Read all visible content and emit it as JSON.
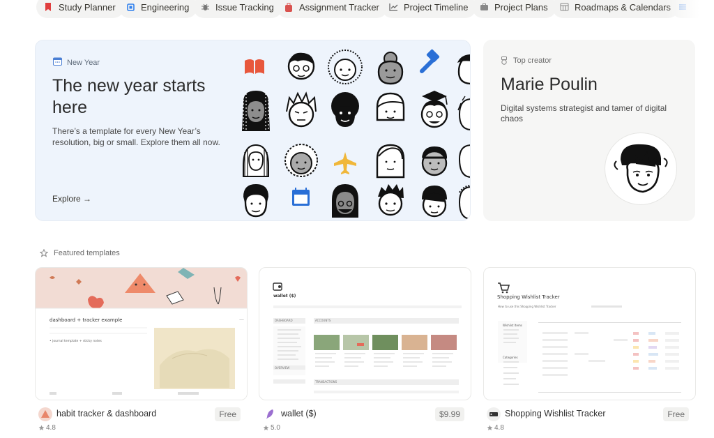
{
  "chips": [
    {
      "label": "Study Planner",
      "icon": "bookmark-icon",
      "color": "#e03e3e"
    },
    {
      "label": "Engineering",
      "icon": "chip-icon",
      "color": "#2f80ed"
    },
    {
      "label": "Issue Tracking",
      "icon": "bug-icon",
      "color": "#6b6b6b"
    },
    {
      "label": "Assignment Tracker",
      "icon": "backpack-icon",
      "color": "#d9534f"
    },
    {
      "label": "Project Timeline",
      "icon": "chart-icon",
      "color": "#6b6b6b"
    },
    {
      "label": "Project Plans",
      "icon": "briefcase-icon",
      "color": "#6b6b6b"
    },
    {
      "label": "Roadmaps & Calendars",
      "icon": "calendar-grid-icon",
      "color": "#6b6b6b"
    }
  ],
  "hero": {
    "eyebrow": "New Year",
    "title": "The new year starts here",
    "description": "There’s a template for every New Year’s resolution, big or small. Explore them all now.",
    "explore": "Explore →",
    "accent": "#eef4fc"
  },
  "creator": {
    "eyebrow": "Top creator",
    "name": "Marie Poulin",
    "bio": "Digital systems strategist and tamer of digital chaos"
  },
  "featured_label": "Featured templates",
  "templates": [
    {
      "title": "habit tracker & dashboard",
      "price": "Free",
      "rating": "4.8",
      "preview": {
        "heading": "dashboard + tracker example",
        "line": "• journal template + sticky notes"
      }
    },
    {
      "title": "wallet ($)",
      "price": "$9.99",
      "rating": "5.0",
      "preview": {
        "heading": "wallet ($)",
        "section1": "DASHBOARD",
        "section2": "ACCOUNTS",
        "section3": "OVERVIEW",
        "section4": "TRANSACTIONS"
      }
    },
    {
      "title": "Shopping Wishlist Tracker",
      "price": "Free",
      "rating": "4.8",
      "preview": {
        "heading": "Shopping Wishlist Tracker",
        "subline": "How to use this Shopping Wishlist Tracker",
        "nav1": "Wishlist Items",
        "nav2": "Categories"
      }
    }
  ]
}
